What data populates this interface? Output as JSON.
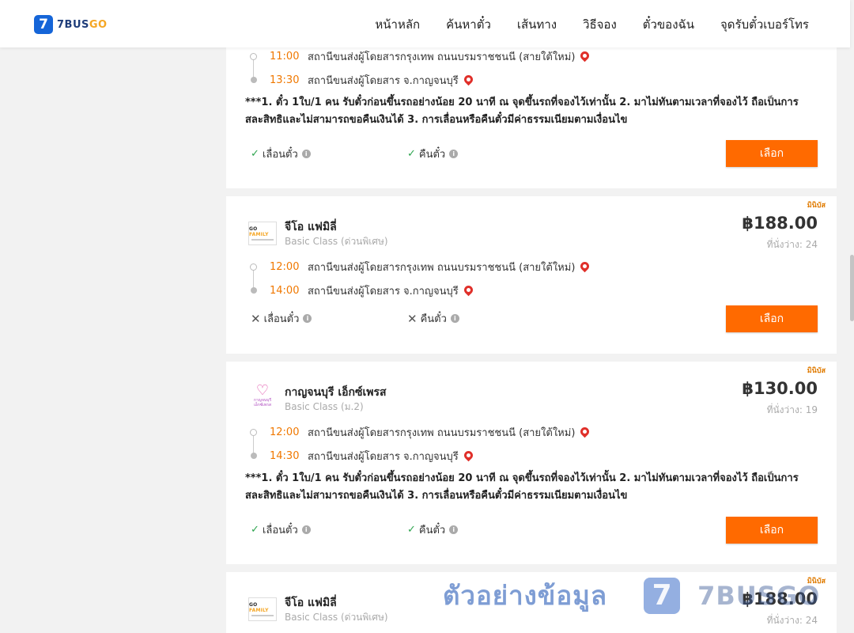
{
  "header": {
    "logo_mark": "7",
    "logo_text_main": "7BUS",
    "logo_text_accent": "GO",
    "nav": [
      "หน้าหลัก",
      "ค้นหาตั๋ว",
      "เส้นทาง",
      "วิธีจอง",
      "ตั๋วของฉัน",
      "จุดรับตั๋วเบอร์โทร"
    ]
  },
  "notice_text": "***1. ตั๋ว 1ใบ/1 คน รับตั๋วก่อนขึ้นรถอย่างน้อย 20 นาที ณ จุดขึ้นรถที่จองไว้เท่านั้น 2. มาไม่ทันตามเวลาที่จองไว้ ถือเป็นการสละสิทธิและไม่สามารถขอคืนเงินได้ 3. การเลื่อนหรือคืนตั๋วมีค่าธรรมเนียมตามเงื่อนไข",
  "labels": {
    "reschedule": "เลื่อนตั๋ว",
    "refund": "คืนตั๋ว",
    "select": "เลือก",
    "info": "i",
    "ok": "✓",
    "no": "✕"
  },
  "cards": [
    {
      "stops": [
        {
          "time": "11:00",
          "place": "สถานีขนส่งผู้โดยสารกรุงเทพ ถนนบรมราชชนนี (สายใต้ใหม่)"
        },
        {
          "time": "13:30",
          "place": "สถานีขนส่งผู้โดยสาร จ.กาญจนบุรี"
        }
      ]
    },
    {
      "tag": "มินิบัส",
      "operator": "จีโอ แฟมิลี่",
      "class": "Basic Class (ด่วนพิเศษ)",
      "price": "฿188.00",
      "seats": "ที่นั่งว่าง: 24",
      "stops": [
        {
          "time": "12:00",
          "place": "สถานีขนส่งผู้โดยสารกรุงเทพ ถนนบรมราชชนนี (สายใต้ใหม่)"
        },
        {
          "time": "14:00",
          "place": "สถานีขนส่งผู้โดยสาร จ.กาญจนบุรี"
        }
      ]
    },
    {
      "tag": "มินิบัส",
      "operator": "กาญจนบุรี เอ็กซ์เพรส",
      "class": "Basic Class (ม.2)",
      "price": "฿130.00",
      "seats": "ที่นั่งว่าง: 19",
      "stops": [
        {
          "time": "12:00",
          "place": "สถานีขนส่งผู้โดยสารกรุงเทพ ถนนบรมราชชนนี (สายใต้ใหม่)"
        },
        {
          "time": "14:30",
          "place": "สถานีขนส่งผู้โดยสาร จ.กาญจนบุรี"
        }
      ]
    },
    {
      "tag": "มินิบัส",
      "operator": "จีโอ แฟมิลี่",
      "class": "Basic Class (ด่วนพิเศษ)",
      "price": "฿188.00",
      "seats": "ที่นั่งว่าง: 24"
    }
  ],
  "logos": {
    "gofamily_a": "GO",
    "gofamily_b": "FAMILY",
    "kanchanaburi": "กาญจนบุรี เอ็กซ์เพรส"
  },
  "watermark": {
    "text": "ตัวอย่างข้อมูล",
    "mark": "7",
    "brand": "7BUSGO"
  },
  "colors": {
    "accent": "#ff6a00",
    "time": "#f07800",
    "brand": "#1565d8",
    "check": "#2da44e"
  }
}
